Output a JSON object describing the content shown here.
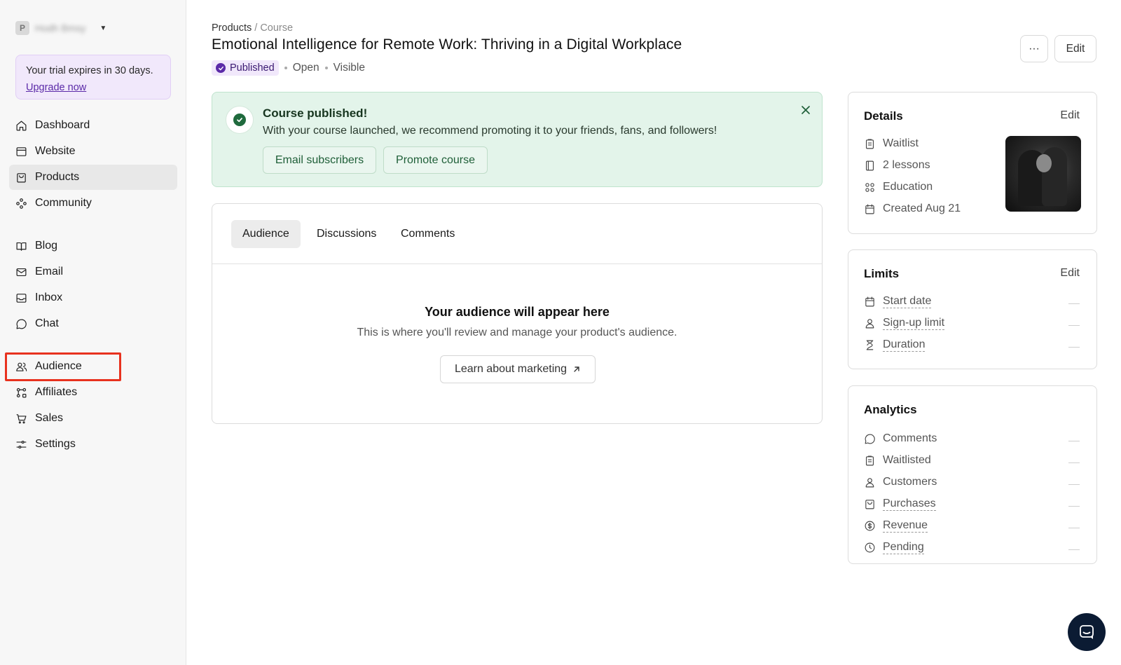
{
  "workspace": {
    "initial": "P",
    "name": "Hodh Bmsy"
  },
  "trial": {
    "text": "Your trial expires in 30 days.",
    "link": "Upgrade now"
  },
  "nav": {
    "dashboard": "Dashboard",
    "website": "Website",
    "products": "Products",
    "community": "Community",
    "blog": "Blog",
    "email": "Email",
    "inbox": "Inbox",
    "chat": "Chat",
    "audience": "Audience",
    "affiliates": "Affiliates",
    "sales": "Sales",
    "settings": "Settings"
  },
  "breadcrumb": {
    "parent": "Products",
    "sep": "/",
    "current": "Course"
  },
  "page": {
    "title": "Emotional Intelligence for Remote Work: Thriving in a Digital Workplace",
    "status": "Published",
    "access": "Open",
    "visibility": "Visible",
    "more_label": "···",
    "edit_label": "Edit"
  },
  "banner": {
    "title": "Course published!",
    "text": "With your course launched, we recommend promoting it to your friends, fans, and followers!",
    "btn_email": "Email subscribers",
    "btn_promote": "Promote course"
  },
  "tabs": {
    "audience": "Audience",
    "discussions": "Discussions",
    "comments": "Comments"
  },
  "empty": {
    "title": "Your audience will appear here",
    "subtitle": "This is where you'll review and manage your product's audience.",
    "button": "Learn about marketing"
  },
  "details": {
    "title": "Details",
    "edit": "Edit",
    "waitlist": "Waitlist",
    "lessons": "2 lessons",
    "category": "Education",
    "created": "Created Aug 21"
  },
  "limits": {
    "title": "Limits",
    "edit": "Edit",
    "start": "Start date",
    "signup": "Sign-up limit",
    "duration": "Duration"
  },
  "analytics": {
    "title": "Analytics",
    "comments": "Comments",
    "waitlisted": "Waitlisted",
    "customers": "Customers",
    "purchases": "Purchases",
    "revenue": "Revenue",
    "pending": "Pending"
  },
  "colors": {
    "accent": "#5b2aa8",
    "success_bg": "#e3f4ea",
    "highlight": "#e8321f",
    "chat_button": "#0b1b33"
  }
}
